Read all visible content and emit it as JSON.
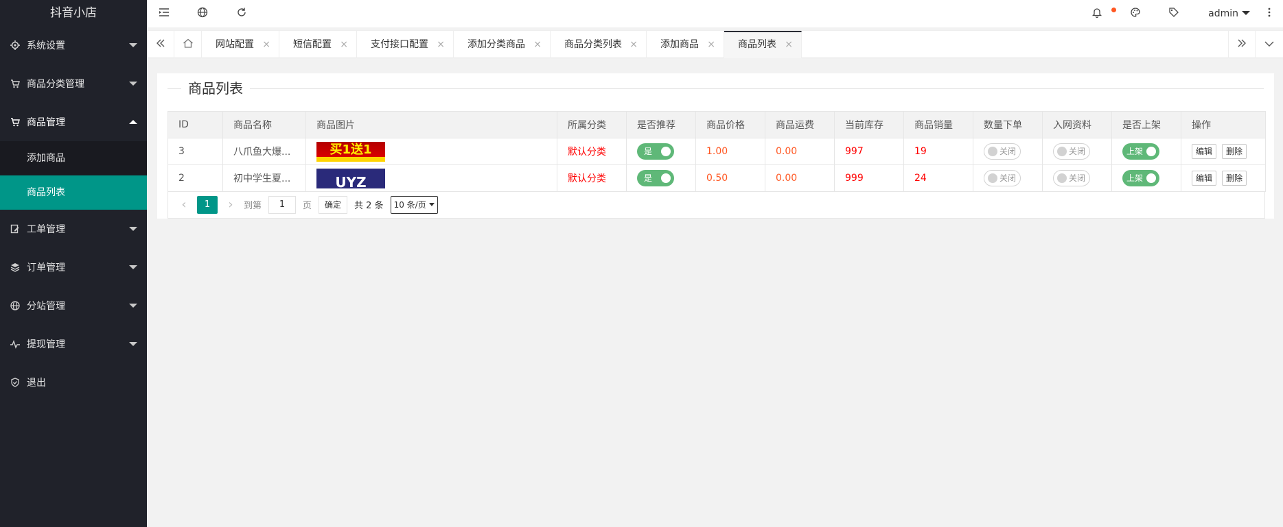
{
  "app": {
    "title": "抖音小店"
  },
  "sidebar": {
    "items": [
      {
        "label": "系统设置",
        "icon": "gear-icon"
      },
      {
        "label": "商品分类管理",
        "icon": "cart-icon"
      },
      {
        "label": "商品管理",
        "icon": "cart-icon",
        "open": true,
        "children": [
          {
            "label": "添加商品"
          },
          {
            "label": "商品列表",
            "active": true
          }
        ]
      },
      {
        "label": "工单管理",
        "icon": "edit-icon"
      },
      {
        "label": "订单管理",
        "icon": "layers-icon"
      },
      {
        "label": "分站管理",
        "icon": "globe-icon"
      },
      {
        "label": "提现管理",
        "icon": "pulse-icon"
      },
      {
        "label": "退出",
        "icon": "shield-icon"
      }
    ]
  },
  "header": {
    "user": "admin"
  },
  "tabs": [
    {
      "label": "网站配置"
    },
    {
      "label": "短信配置"
    },
    {
      "label": "支付接口配置"
    },
    {
      "label": "添加分类商品"
    },
    {
      "label": "商品分类列表"
    },
    {
      "label": "添加商品"
    },
    {
      "label": "商品列表",
      "active": true
    }
  ],
  "page": {
    "title": "商品列表"
  },
  "table": {
    "headers": [
      "ID",
      "商品名称",
      "商品图片",
      "所属分类",
      "是否推荐",
      "商品价格",
      "商品运费",
      "当前库存",
      "商品销量",
      "数量下单",
      "入网资料",
      "是否上架",
      "操作"
    ],
    "rows": [
      {
        "id": "3",
        "name": "八爪鱼大爆...",
        "image_text": "买1送1",
        "category": "默认分类",
        "recommend": "是",
        "price": "1.00",
        "shipping": "0.00",
        "stock": "997",
        "sales": "19",
        "qty_order": "关闭",
        "net_info": "关闭",
        "on_shelf": "上架",
        "edit": "编辑",
        "delete": "删除"
      },
      {
        "id": "2",
        "name": "初中学生夏...",
        "image_text": "UYZ",
        "category": "默认分类",
        "recommend": "是",
        "price": "0.50",
        "shipping": "0.00",
        "stock": "999",
        "sales": "24",
        "qty_order": "关闭",
        "net_info": "关闭",
        "on_shelf": "上架",
        "edit": "编辑",
        "delete": "删除"
      }
    ]
  },
  "pagination": {
    "current": "1",
    "goto_label": "到第",
    "goto_value": "1",
    "page_label": "页",
    "confirm": "确定",
    "total": "共 2 条",
    "page_size": "10 条/页"
  },
  "colors": {
    "accent": "#009688",
    "sidebar_bg": "#20222a",
    "switch_on": "#5fb878",
    "danger": "#ff0000",
    "warn": "#ff5722"
  }
}
